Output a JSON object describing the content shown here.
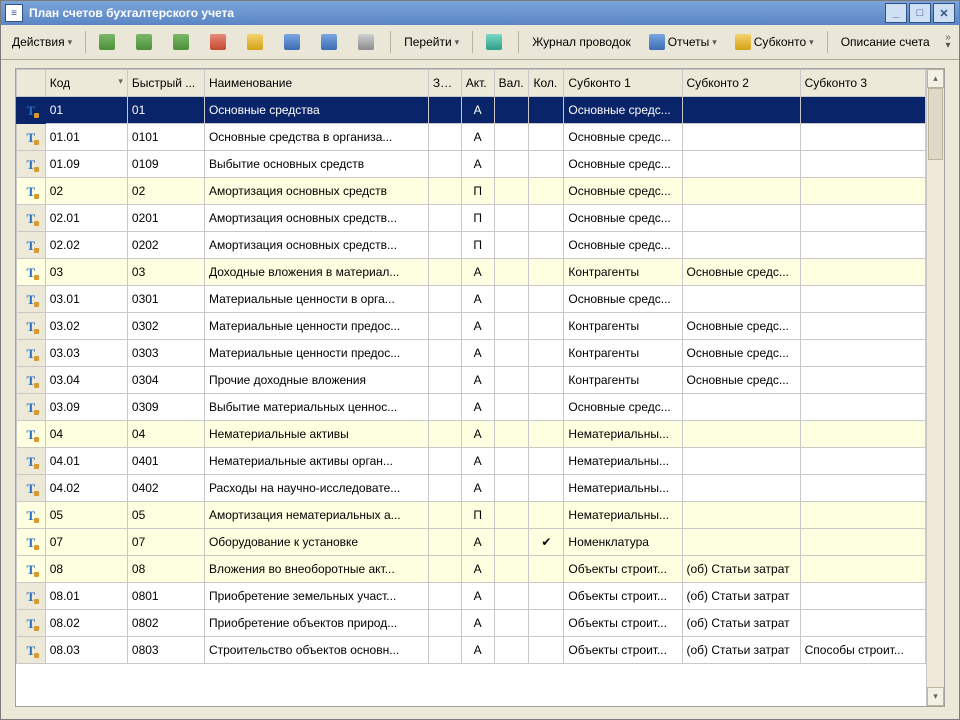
{
  "window": {
    "title": "План счетов бухгалтерского учета"
  },
  "toolbar": {
    "actions": "Действия",
    "go": "Перейти",
    "journal": "Журнал проводок",
    "reports": "Отчеты",
    "subkonto": "Субконто",
    "desc": "Описание счета"
  },
  "columns": {
    "kod": "Код",
    "fast": "Быстрый ...",
    "name": "Наименование",
    "zab": "Заб.",
    "akt": "Акт.",
    "val": "Вал.",
    "kol": "Кол.",
    "s1": "Субконто 1",
    "s2": "Субконто 2",
    "s3": "Субконто 3"
  },
  "rows": [
    {
      "group": true,
      "sel": true,
      "kod": "01",
      "fast": "01",
      "name": "Основные средства",
      "akt": "А",
      "s1": "Основные средс...",
      "s2": "",
      "s3": ""
    },
    {
      "kod": "01.01",
      "fast": "0101",
      "name": "Основные средства в организа...",
      "akt": "А",
      "s1": "Основные средс...",
      "s2": "",
      "s3": ""
    },
    {
      "kod": "01.09",
      "fast": "0109",
      "name": "Выбытие основных средств",
      "akt": "А",
      "s1": "Основные средс...",
      "s2": "",
      "s3": ""
    },
    {
      "group": true,
      "kod": "02",
      "fast": "02",
      "name": "Амортизация основных средств",
      "akt": "П",
      "s1": "Основные средс...",
      "s2": "",
      "s3": ""
    },
    {
      "kod": "02.01",
      "fast": "0201",
      "name": "Амортизация основных средств...",
      "akt": "П",
      "s1": "Основные средс...",
      "s2": "",
      "s3": ""
    },
    {
      "kod": "02.02",
      "fast": "0202",
      "name": "Амортизация основных средств...",
      "akt": "П",
      "s1": "Основные средс...",
      "s2": "",
      "s3": ""
    },
    {
      "group": true,
      "kod": "03",
      "fast": "03",
      "name": "Доходные вложения в материал...",
      "akt": "А",
      "s1": "Контрагенты",
      "s2": "Основные средс...",
      "s3": ""
    },
    {
      "kod": "03.01",
      "fast": "0301",
      "name": "Материальные ценности в орга...",
      "akt": "А",
      "s1": "Основные средс...",
      "s2": "",
      "s3": ""
    },
    {
      "kod": "03.02",
      "fast": "0302",
      "name": "Материальные ценности предос...",
      "akt": "А",
      "s1": "Контрагенты",
      "s2": "Основные средс...",
      "s3": ""
    },
    {
      "kod": "03.03",
      "fast": "0303",
      "name": "Материальные ценности предос...",
      "akt": "А",
      "s1": "Контрагенты",
      "s2": "Основные средс...",
      "s3": ""
    },
    {
      "kod": "03.04",
      "fast": "0304",
      "name": "Прочие доходные вложения",
      "akt": "А",
      "s1": "Контрагенты",
      "s2": "Основные средс...",
      "s3": ""
    },
    {
      "kod": "03.09",
      "fast": "0309",
      "name": "Выбытие материальных ценнос...",
      "akt": "А",
      "s1": "Основные средс...",
      "s2": "",
      "s3": ""
    },
    {
      "group": true,
      "kod": "04",
      "fast": "04",
      "name": "Нематериальные активы",
      "akt": "А",
      "s1": "Нематериальны...",
      "s2": "",
      "s3": ""
    },
    {
      "kod": "04.01",
      "fast": "0401",
      "name": "Нематериальные активы орган...",
      "akt": "А",
      "s1": "Нематериальны...",
      "s2": "",
      "s3": ""
    },
    {
      "kod": "04.02",
      "fast": "0402",
      "name": "Расходы на научно-исследовате...",
      "akt": "А",
      "s1": "Нематериальны...",
      "s2": "",
      "s3": ""
    },
    {
      "group": true,
      "kod": "05",
      "fast": "05",
      "name": "Амортизация нематериальных а...",
      "akt": "П",
      "s1": "Нематериальны...",
      "s2": "",
      "s3": ""
    },
    {
      "group": true,
      "kod": "07",
      "fast": "07",
      "name": "Оборудование к установке",
      "akt": "А",
      "kol": "✔",
      "s1": "Номенклатура",
      "s2": "",
      "s3": ""
    },
    {
      "group": true,
      "kod": "08",
      "fast": "08",
      "name": "Вложения во внеоборотные акт...",
      "akt": "А",
      "s1": "Объекты строит...",
      "s2": "(об) Статьи затрат",
      "s3": ""
    },
    {
      "kod": "08.01",
      "fast": "0801",
      "name": "Приобретение земельных участ...",
      "akt": "А",
      "s1": "Объекты строит...",
      "s2": "(об) Статьи затрат",
      "s3": ""
    },
    {
      "kod": "08.02",
      "fast": "0802",
      "name": "Приобретение объектов природ...",
      "akt": "А",
      "s1": "Объекты строит...",
      "s2": "(об) Статьи затрат",
      "s3": ""
    },
    {
      "kod": "08.03",
      "fast": "0803",
      "name": "Строительство объектов основн...",
      "akt": "А",
      "s1": "Объекты строит...",
      "s2": "(об) Статьи затрат",
      "s3": "Способы строит..."
    }
  ]
}
